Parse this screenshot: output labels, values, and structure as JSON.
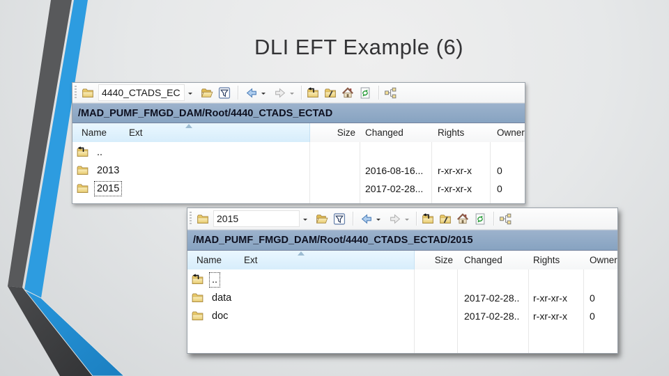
{
  "slide": {
    "title": "DLI EFT Example (6)"
  },
  "colors": {
    "stripe_blue": "#2d9ce0",
    "stripe_blue_dark": "#1e86c4",
    "stripe_gray": "#58595b",
    "stripe_gray_dark": "#3c3d3f",
    "address_bar_bg": "#8fa9c7",
    "header_highlight": "#ddeffc",
    "folder_yellow": "#eccf70"
  },
  "icons": {
    "toolbar": [
      "session-folder-icon",
      "dropdown-caret-icon",
      "open-directory-icon",
      "filter-icon",
      "back-icon",
      "forward-icon",
      "parent-directory-icon",
      "root-directory-icon",
      "home-directory-icon",
      "refresh-icon",
      "directory-tree-icon"
    ],
    "row_folder": "folder-icon",
    "row_up": "folder-up-icon",
    "sort": "sort-ascending-icon"
  },
  "window1": {
    "combo_value": "4440_CTADS_EC",
    "address": "/MAD_PUMF_FMGD_DAM/Root/4440_CTADS_ECTAD",
    "columns": [
      "Name",
      "Ext",
      "Size",
      "Changed",
      "Rights",
      "Owner"
    ],
    "rows": [
      {
        "name": "..",
        "changed": "",
        "rights": "",
        "owner": ""
      },
      {
        "name": "2013",
        "changed": "2016-08-16...",
        "rights": "r-xr-xr-x",
        "owner": "0"
      },
      {
        "name": "2015",
        "changed": "2017-02-28...",
        "rights": "r-xr-xr-x",
        "owner": "0",
        "focused": true
      }
    ]
  },
  "window2": {
    "combo_value": "2015",
    "address": "/MAD_PUMF_FMGD_DAM/Root/4440_CTADS_ECTAD/2015",
    "columns": [
      "Name",
      "Ext",
      "Size",
      "Changed",
      "Rights",
      "Owner"
    ],
    "rows": [
      {
        "name": "..",
        "changed": "",
        "rights": "",
        "owner": "",
        "focused": true
      },
      {
        "name": "data",
        "changed": "2017-02-28..",
        "rights": "r-xr-xr-x",
        "owner": "0"
      },
      {
        "name": "doc",
        "changed": "2017-02-28..",
        "rights": "r-xr-xr-x",
        "owner": "0"
      }
    ]
  }
}
